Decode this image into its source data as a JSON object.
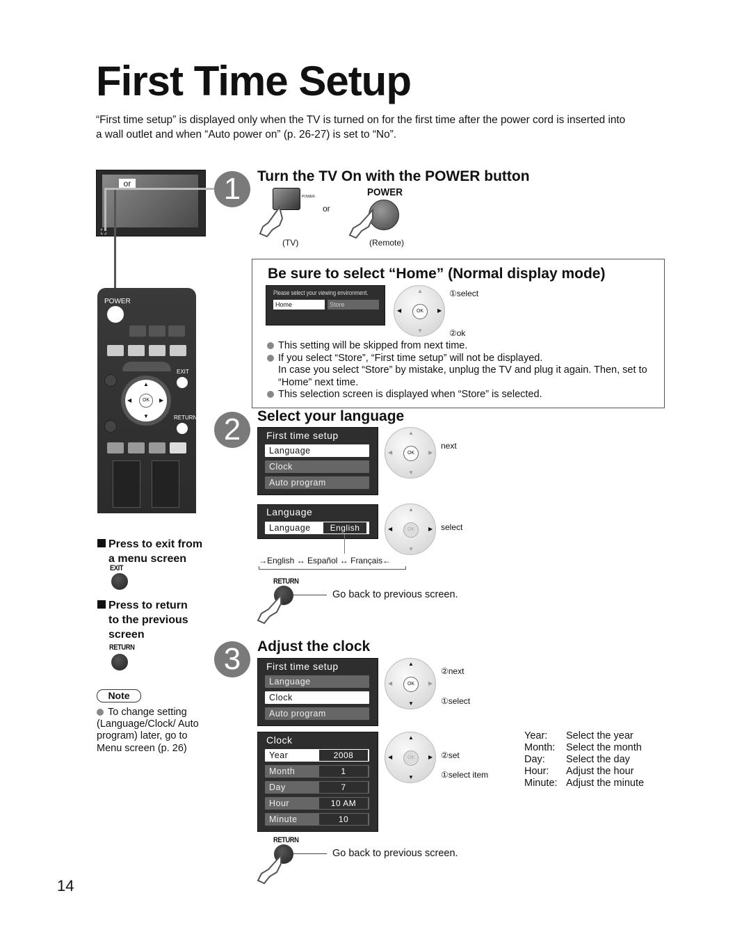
{
  "page": {
    "title": "First Time Setup",
    "intro": "“First time setup” is displayed only when the TV is turned on for the first time after the power cord is inserted into a wall outlet and when “Auto power on” (p. 26-27) is set to “No”.",
    "page_number": "14"
  },
  "tv": {
    "or_label": "or"
  },
  "remote": {
    "power_label": "POWER",
    "exit_label": "EXIT",
    "return_label": "RETURN",
    "ok_label": "OK"
  },
  "step1": {
    "number": "1",
    "heading": "Turn the TV On with the POWER button",
    "tv_button_label": "POWER",
    "remote_button_label": "POWER",
    "or_label": "or",
    "tv_caption": "(TV)",
    "remote_caption": "(Remote)"
  },
  "home_box": {
    "heading": "Be sure to select “Home” (Normal display mode)",
    "osd_prompt": "Please select your viewing environment.",
    "options": [
      "Home",
      "Store"
    ],
    "ok_label": "OK",
    "callout_select": "①select",
    "callout_ok": "②ok",
    "bullets": [
      "This setting will be skipped from next time.",
      "If you select “Store”, “First time setup” will not be displayed.",
      "This selection screen is displayed when “Store” is selected."
    ],
    "bullet2_continuation": "In case you select “Store” by mistake, unplug the TV and plug it again. Then, set to “Home” next time."
  },
  "step2": {
    "number": "2",
    "heading": "Select your language",
    "menu_title": "First time setup",
    "menu_items": [
      "Language",
      "Clock",
      "Auto program"
    ],
    "callout_next": "next",
    "lang_menu_title": "Language",
    "lang_row_label": "Language",
    "lang_value": "English",
    "callout_select": "select",
    "cycle": [
      "English",
      "Español",
      "Français"
    ],
    "return_label": "RETURN",
    "return_caption": "Go back to previous screen."
  },
  "sidebar": {
    "exit_heading_1": "Press to exit from",
    "exit_heading_2": "a menu screen",
    "exit_button_label": "EXIT",
    "return_heading_1": "Press to return",
    "return_heading_2": "to the previous",
    "return_heading_3": "screen",
    "return_button_label": "RETURN",
    "note_label": "Note",
    "note_text": "To change setting (Language/Clock/ Auto program) later, go to Menu screen (p. 26)"
  },
  "step3": {
    "number": "3",
    "heading": "Adjust the clock",
    "menu_title": "First time setup",
    "menu_items": [
      "Language",
      "Clock",
      "Auto program"
    ],
    "callout_next": "②next",
    "callout_select": "①select",
    "clock_title": "Clock",
    "clock_rows": [
      {
        "label": "Year",
        "value": "2008"
      },
      {
        "label": "Month",
        "value": "1"
      },
      {
        "label": "Day",
        "value": "7"
      },
      {
        "label": "Hour",
        "value": "10 AM"
      },
      {
        "label": "Minute",
        "value": "10"
      }
    ],
    "callout_set": "②set",
    "callout_select_item": "①select item",
    "legend": [
      {
        "key": "Year:",
        "desc": "Select the year"
      },
      {
        "key": "Month:",
        "desc": "Select the month"
      },
      {
        "key": "Day:",
        "desc": "Select the day"
      },
      {
        "key": "Hour:",
        "desc": "Adjust the hour"
      },
      {
        "key": "Minute:",
        "desc": "Adjust the minute"
      }
    ],
    "return_label": "RETURN",
    "return_caption": "Go back to previous screen."
  }
}
